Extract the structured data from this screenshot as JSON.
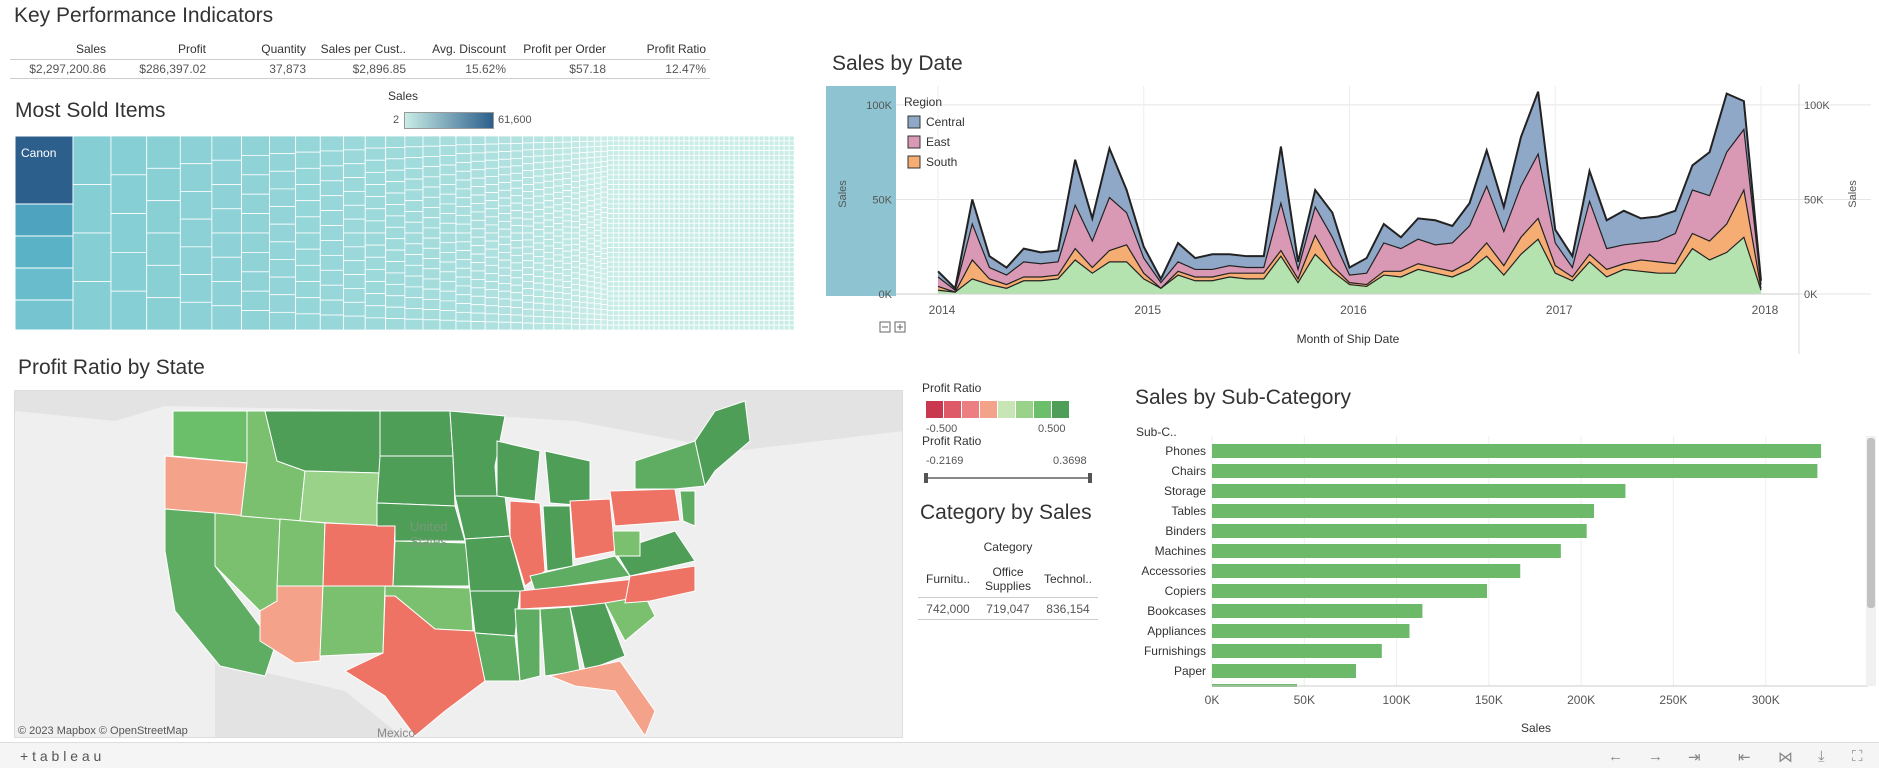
{
  "kpi": {
    "title": "Key Performance Indicators",
    "headers": [
      "Sales",
      "Profit",
      "Quantity",
      "Sales per Cust..",
      "Avg. Discount",
      "Profit per Order",
      "Profit Ratio"
    ],
    "values": [
      "$2,297,200.86",
      "$286,397.02",
      "37,873",
      "$2,896.85",
      "15.62%",
      "$57.18",
      "12.47%"
    ]
  },
  "most_sold": {
    "title": "Most Sold Items",
    "legend_title": "Sales",
    "legend_min": "2",
    "legend_max": "61,600",
    "top_item": "Canon"
  },
  "sales_by_date": {
    "title": "Sales by Date",
    "legend_title": "Region",
    "legend_items": [
      "Central",
      "East",
      "South"
    ],
    "y_label_left": "Sales",
    "y_label_right": "Sales",
    "x_label": "Month of Ship Date",
    "y_ticks": [
      "100K",
      "50K",
      "0K"
    ],
    "y_ticks_right": [
      "100K",
      "50K",
      "0K"
    ],
    "x_ticks": [
      "2014",
      "2015",
      "2016",
      "2017",
      "2018"
    ],
    "colors": {
      "central": "#8fa8c8",
      "east": "#d999b5",
      "south": "#f5ad73",
      "west": "#b5e3b0",
      "panel": "#8ec4d1"
    }
  },
  "profit_map": {
    "title": "Profit Ratio by State",
    "credits": "© 2023 Mapbox  © OpenStreetMap",
    "country_label_1": "United",
    "country_label_2": "States",
    "mexico_label": "Mexico"
  },
  "profit_legend": {
    "title": "Profit Ratio",
    "min": "-0.500",
    "max": "0.500",
    "filter_title": "Profit Ratio",
    "filter_min": "-0.2169",
    "filter_max": "0.3698"
  },
  "category": {
    "title": "Category by Sales",
    "header": "Category",
    "columns": [
      "Furnitu..",
      "Office Supplies",
      "Technol.."
    ],
    "values": [
      "742,000",
      "719,047",
      "836,154"
    ]
  },
  "subcat": {
    "title": "Sales by Sub-Category",
    "header": "Sub-C..",
    "x_label": "Sales",
    "x_ticks": [
      "0K",
      "50K",
      "100K",
      "150K",
      "200K",
      "250K",
      "300K"
    ]
  },
  "footer": {
    "brand": "+ t a b l e a u"
  },
  "chart_data": [
    {
      "type": "area",
      "title": "Sales by Date",
      "xlabel": "Month of Ship Date",
      "ylabel": "Sales",
      "ylim": [
        0,
        110000
      ],
      "x": [
        "2014-01",
        "2014-02",
        "2014-03",
        "2014-04",
        "2014-05",
        "2014-06",
        "2014-07",
        "2014-08",
        "2014-09",
        "2014-10",
        "2014-11",
        "2014-12",
        "2015-01",
        "2015-02",
        "2015-03",
        "2015-04",
        "2015-05",
        "2015-06",
        "2015-07",
        "2015-08",
        "2015-09",
        "2015-10",
        "2015-11",
        "2015-12",
        "2016-01",
        "2016-02",
        "2016-03",
        "2016-04",
        "2016-05",
        "2016-06",
        "2016-07",
        "2016-08",
        "2016-09",
        "2016-10",
        "2016-11",
        "2016-12",
        "2017-01",
        "2017-02",
        "2017-03",
        "2017-04",
        "2017-05",
        "2017-06",
        "2017-07",
        "2017-08",
        "2017-09",
        "2017-10",
        "2017-11",
        "2017-12",
        "2018-01"
      ],
      "series": [
        {
          "name": "West",
          "values": [
            2000,
            1000,
            8000,
            5000,
            3000,
            7000,
            7000,
            8000,
            18000,
            11000,
            17000,
            17000,
            8000,
            3000,
            10000,
            7000,
            7000,
            9000,
            8000,
            8000,
            20000,
            6000,
            21000,
            12000,
            5000,
            4000,
            10000,
            9000,
            13000,
            11000,
            9000,
            13000,
            20000,
            10000,
            21000,
            29000,
            11000,
            7000,
            17000,
            9000,
            13000,
            12000,
            11000,
            11000,
            24000,
            18000,
            22000,
            30000,
            2000
          ]
        },
        {
          "name": "South",
          "values": [
            4000,
            1000,
            18000,
            8000,
            5000,
            9000,
            9000,
            10000,
            24000,
            14000,
            23000,
            26000,
            11000,
            3000,
            12000,
            9000,
            9000,
            11000,
            11000,
            11000,
            23000,
            8000,
            31000,
            15000,
            6000,
            5000,
            12000,
            12000,
            16000,
            14000,
            12000,
            17000,
            27000,
            15000,
            30000,
            40000,
            15000,
            9000,
            21000,
            13000,
            16000,
            18000,
            17000,
            16000,
            32000,
            28000,
            37000,
            55000,
            3000
          ]
        },
        {
          "name": "East",
          "values": [
            9000,
            2000,
            37000,
            14000,
            10000,
            17000,
            16000,
            17000,
            47000,
            28000,
            51000,
            43000,
            19000,
            6000,
            17000,
            13000,
            13000,
            15000,
            14000,
            14000,
            48000,
            13000,
            46000,
            30000,
            10000,
            11000,
            27000,
            24000,
            29000,
            26000,
            27000,
            36000,
            57000,
            33000,
            57000,
            74000,
            27000,
            14000,
            49000,
            24000,
            26000,
            27000,
            28000,
            32000,
            55000,
            52000,
            75000,
            87000,
            5000
          ]
        },
        {
          "name": "Central",
          "values": [
            12000,
            3000,
            50000,
            20000,
            14000,
            24000,
            22000,
            23000,
            71000,
            40000,
            77000,
            55000,
            25000,
            8000,
            27000,
            19000,
            21000,
            21000,
            20000,
            20000,
            78000,
            17000,
            55000,
            43000,
            14000,
            19000,
            37000,
            30000,
            40000,
            39000,
            36000,
            48000,
            76000,
            46000,
            83000,
            107000,
            34000,
            20000,
            65000,
            39000,
            44000,
            40000,
            41000,
            44000,
            68000,
            75000,
            106000,
            102000,
            7000
          ]
        }
      ]
    },
    {
      "type": "bar",
      "title": "Sales by Sub-Category",
      "xlabel": "Sales",
      "categories": [
        "Phones",
        "Chairs",
        "Storage",
        "Tables",
        "Binders",
        "Machines",
        "Accessories",
        "Copiers",
        "Bookcases",
        "Appliances",
        "Furnishings",
        "Paper"
      ],
      "values": [
        330000,
        328000,
        224000,
        207000,
        203000,
        189000,
        167000,
        149000,
        114000,
        107000,
        92000,
        78000
      ],
      "xlim": [
        0,
        350000
      ]
    },
    {
      "type": "table",
      "title": "Category by Sales",
      "categories": [
        "Furnitu..",
        "Office Supplies",
        "Technol.."
      ],
      "values": [
        742000,
        719047,
        836154
      ]
    }
  ]
}
